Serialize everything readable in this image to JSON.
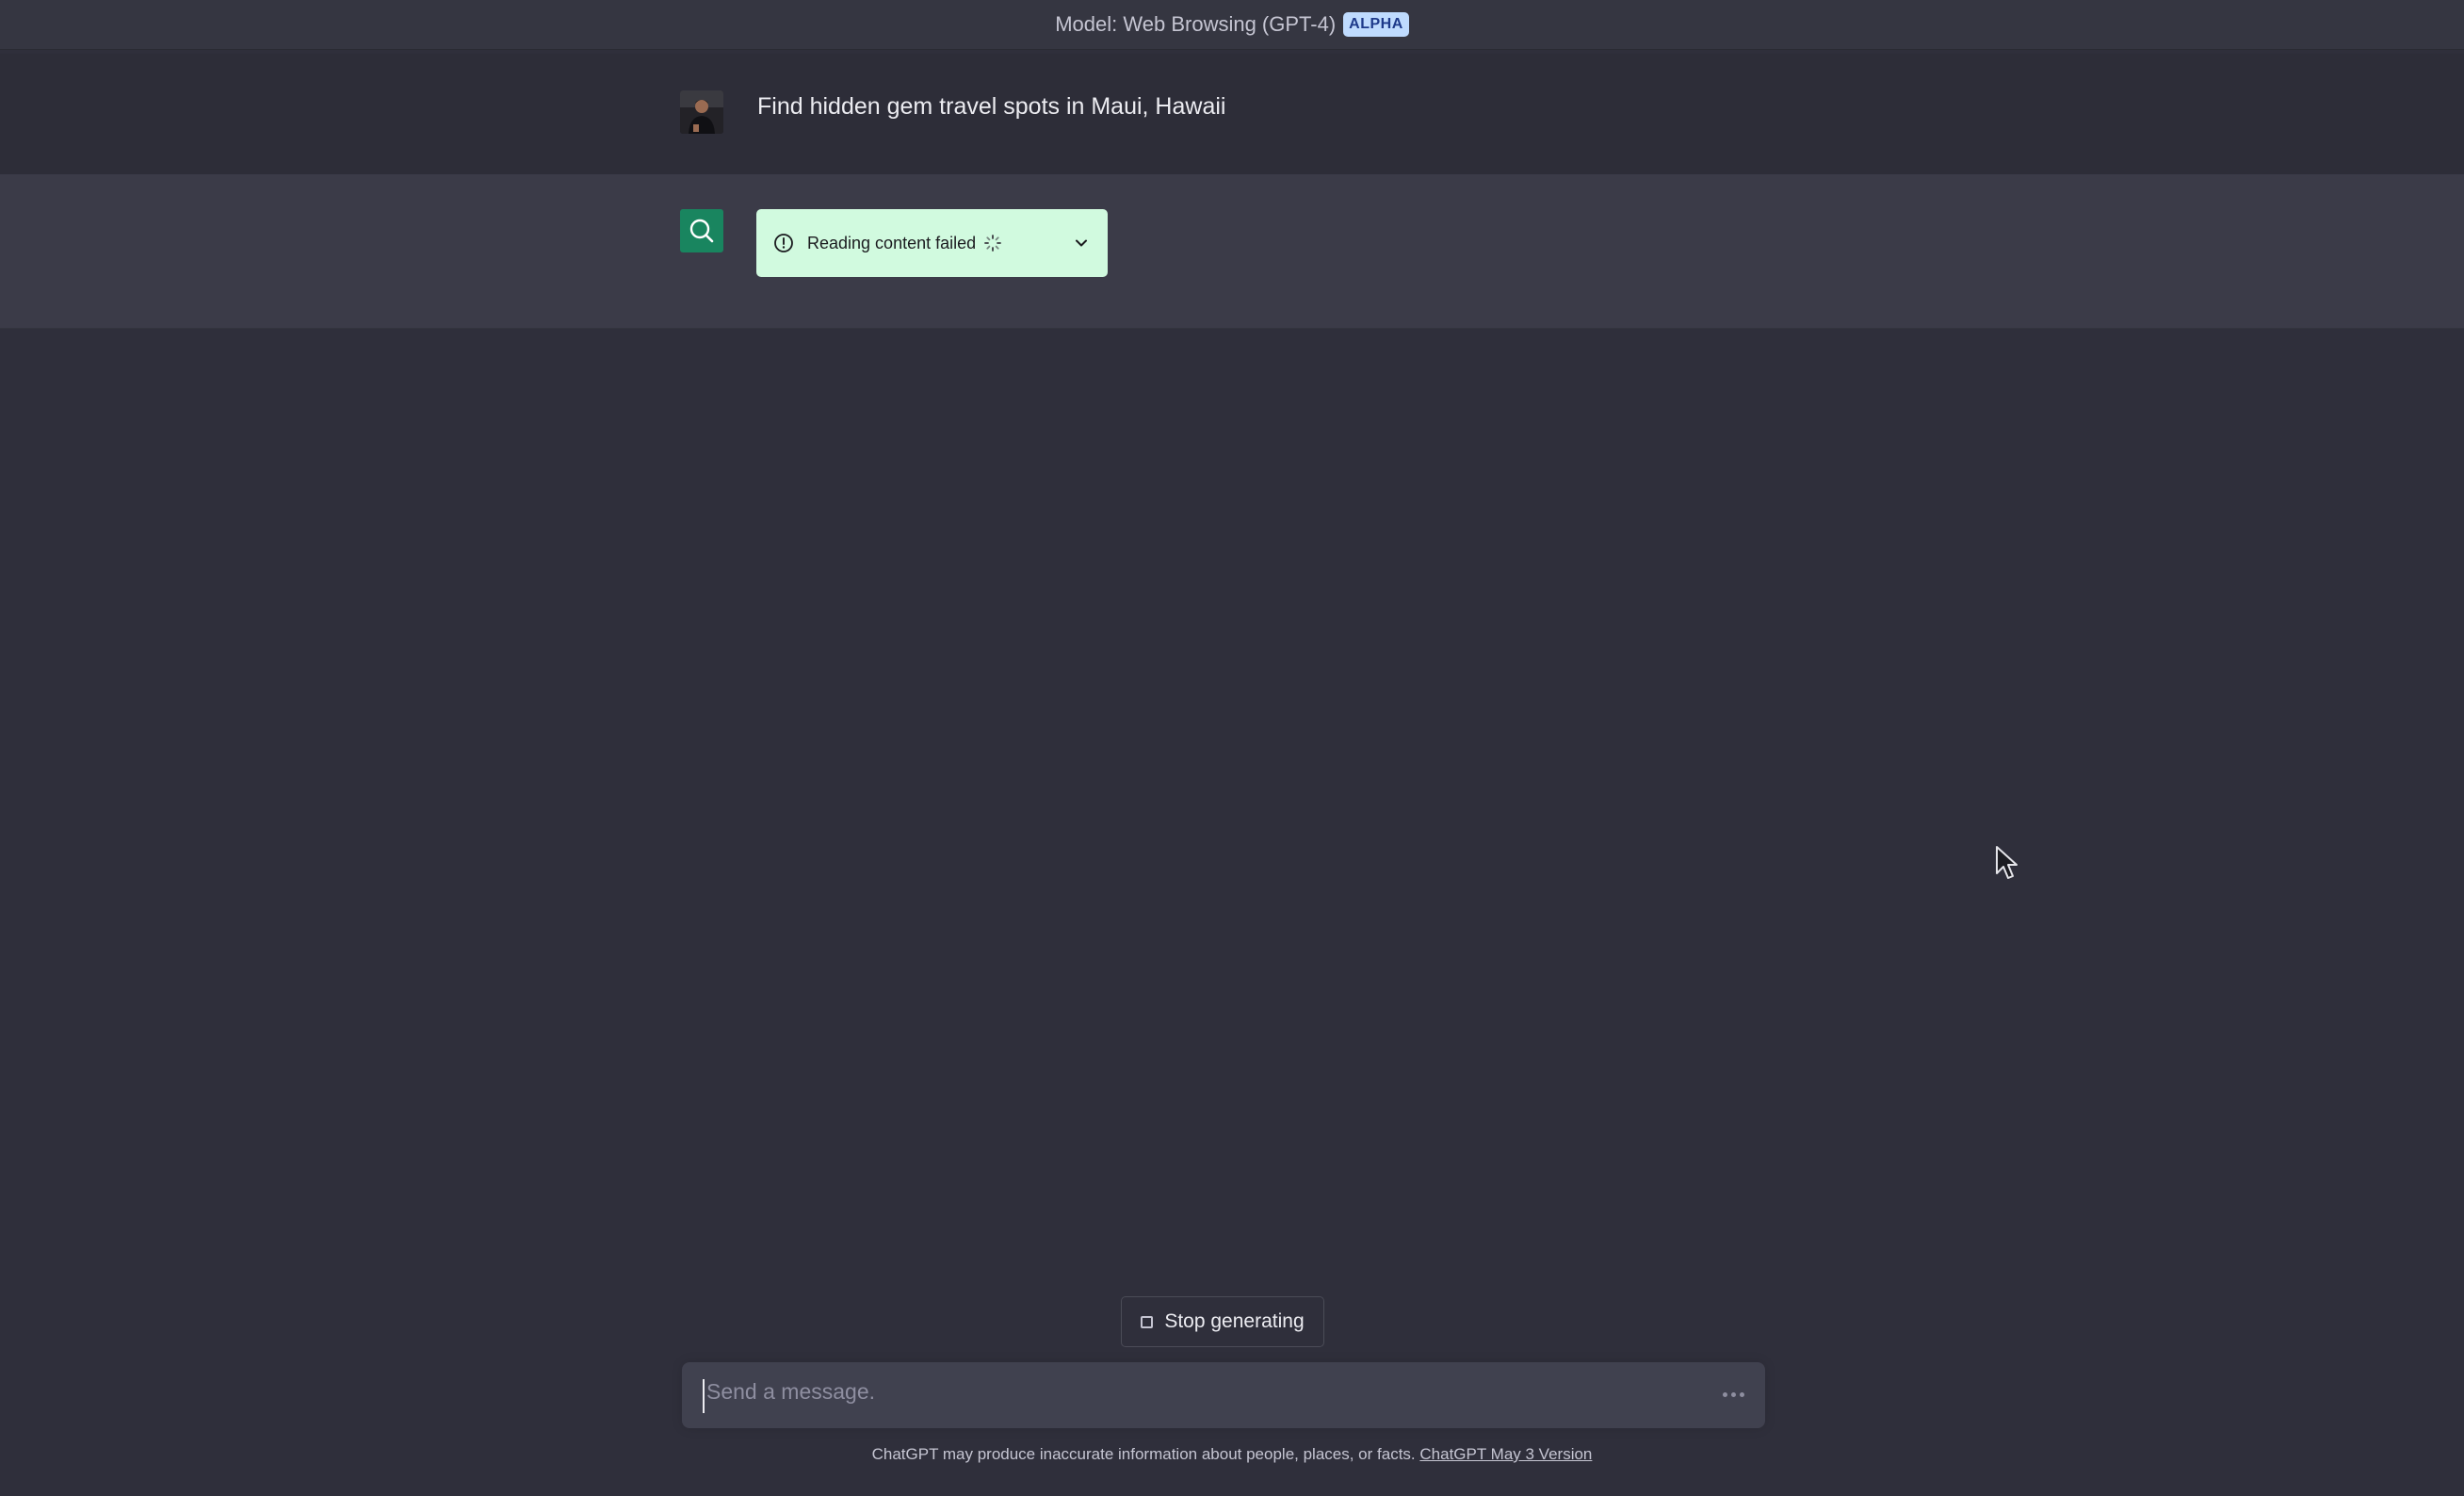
{
  "header": {
    "model_label": "Model: Web Browsing (GPT-4)",
    "badge": "ALPHA"
  },
  "conversation": {
    "user_message": "Find hidden gem travel spots in Maui, Hawaii",
    "assistant_status": "Reading content failed"
  },
  "controls": {
    "stop_label": "Stop generating"
  },
  "composer": {
    "placeholder": "Send a message."
  },
  "footer": {
    "disclaimer": "ChatGPT may produce inaccurate information about people, places, or facts.",
    "version_link": "ChatGPT May 3 Version"
  },
  "icons": {
    "assistant": "search-icon",
    "status": "alert-circle-icon",
    "spinner": "loading-spinner-icon",
    "expand": "chevron-down-icon",
    "more": "more-horizontal-icon"
  },
  "colors": {
    "background": "#2f2f3b",
    "assistant_row": "#3b3b48",
    "status_pill": "#d1fadf",
    "assistant_avatar": "#19855f",
    "badge_bg": "#bfdbfe"
  }
}
